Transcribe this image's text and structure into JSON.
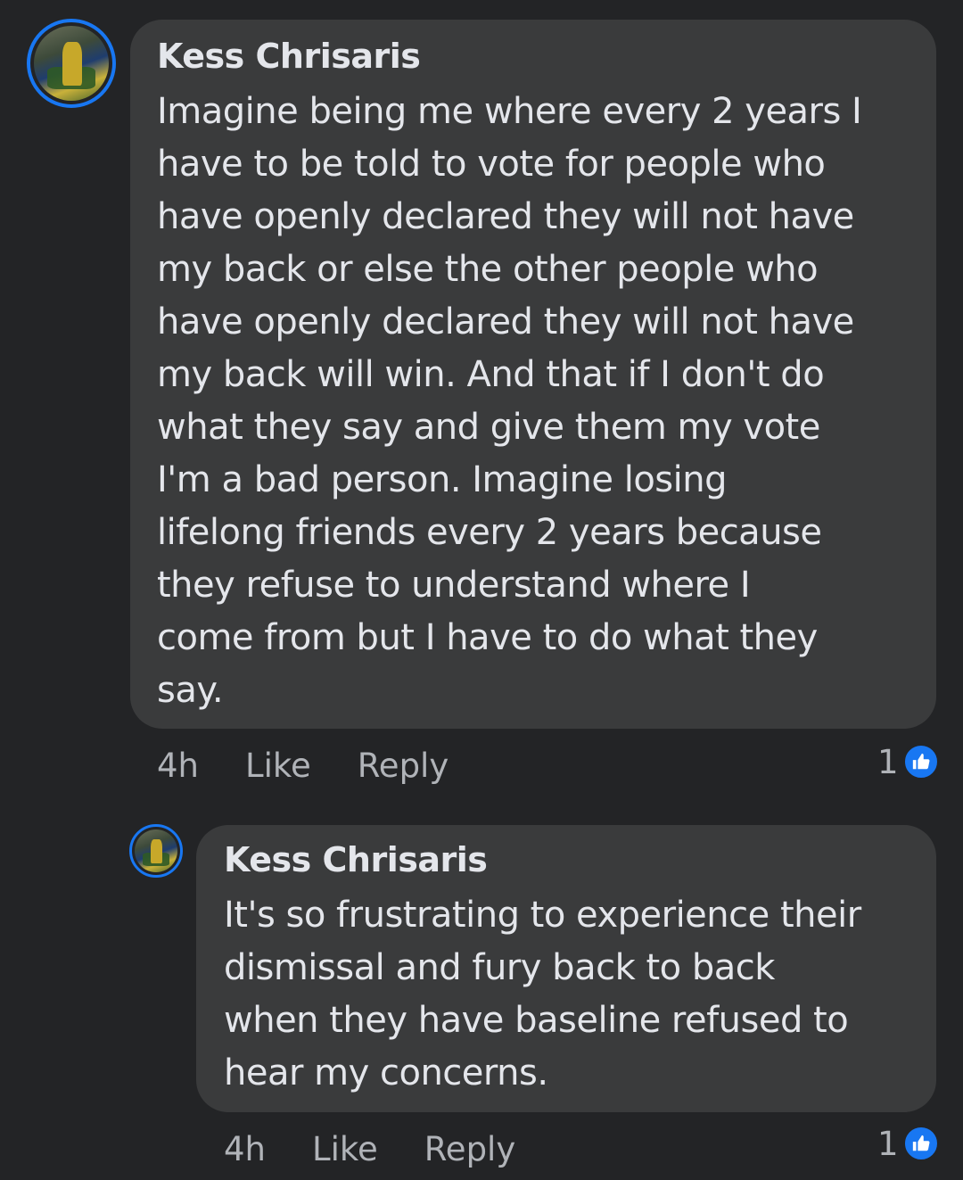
{
  "comments": [
    {
      "author": "Kess Chrisaris",
      "text": "Imagine being me where every 2 years I\nhave to be told to vote for people who\nhave openly declared they will not have\nmy back or else the other people who\nhave openly declared they will not have\nmy back will win.  And that if I don't do\nwhat they say and give them my vote\nI'm a bad person.  Imagine losing\nlifelong friends every 2 years because\nthey refuse to understand where I\ncome from but I have to do what they\nsay.",
      "time": "4h",
      "like_label": "Like",
      "reply_label": "Reply",
      "reaction_count": "1",
      "reaction_icon": "thumbs-up-icon",
      "accent": "#1877f2"
    },
    {
      "author": "Kess Chrisaris",
      "text": "It's so frustrating to experience their\ndismissal and fury back to back\nwhen they have baseline refused to\nhear my concerns.",
      "time": "4h",
      "like_label": "Like",
      "reply_label": "Reply",
      "reaction_count": "1",
      "reaction_icon": "thumbs-up-icon",
      "accent": "#1877f2"
    }
  ]
}
